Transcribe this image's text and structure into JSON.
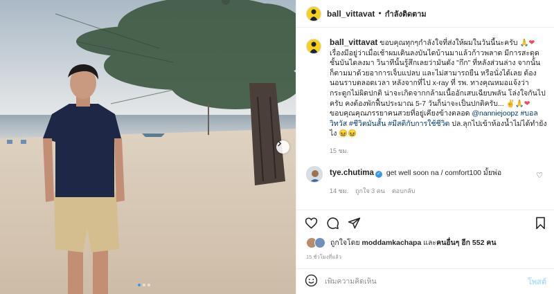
{
  "post": {
    "username": "ball_vittavat",
    "follow_state": "กำลังติดตาม",
    "separator": "•"
  },
  "caption": {
    "username": "ball_vittavat",
    "text_1": "ขอบคุณทุกๆกำลังใจที่ส่งให้ผมในวันนี้นะครับ",
    "emoji_1": "🙏",
    "heart_1": "❤",
    "text_2": " เรื่องมีอยู่ว่าเมื่อเช้าผมเดินลงบันไดบ้านมาแล้วก้าวพลาด มีการสะดุดชั้นบันไดลงมา วินาทีนั้นรู้สึกเลยว่ามันดัง \"กึก\" ที่หลังส่วนล่าง จากนั้นก็ตามมาด้วยอาการเจ็บแปลบ และไม่สามารถยืน หรือนั่งได้เลย ต้องนอนราบตลอดเวลา หลังจากที่ไป x-ray ที่ รพ. ทางคุณหมอแจ้งว่ากระดูกไม่ผิดปกติ น่าจะเกิดจากกล้ามเนื้ออักเสบเฉียบพลัน โล่งใจกันไปครับ คงต้องพักฟื้นประมาณ 5-7 วันก็น่าจะเป็นปกติครับ...",
    "emoji_2": "✌🙏",
    "heart_2": "❤",
    "text_3": " ขอบคุณคุณภรรยาคนสวยที่อยู่เคียงข้างตลอด ",
    "mention": "@nanniejoopz",
    "hashtag_1": "#บอลวิทวัส",
    "hashtag_2": "#ชีวิตมันสั้น",
    "hashtag_3": "#มีสติกับการใช้ชีวิต",
    "text_4": " ปล.ลุกไปเข้าห้องน้ำไม่ได้ทำยังไง",
    "emoji_3": "😖😖",
    "time": "15 ชม."
  },
  "comment": {
    "username": "tye.chutima",
    "verified_mark": "✓",
    "text": "get well soon na / comfort100 มั้ยพ่อ",
    "time": "14 ชม.",
    "likes": "ถูกใจ 3 คน",
    "reply_label": "ตอบกลับ",
    "heart_icon": "♡"
  },
  "likes": {
    "prefix": "ถูกใจโดย",
    "user": "moddamkachapa",
    "middle": "และ",
    "others": "คนอื่นๆ อีก 552 คน"
  },
  "post_date": "15 ชั่วโมงที่แล้ว",
  "add_comment": {
    "placeholder": "เพิ่มความคิดเห็น",
    "post_label": "โพสต์"
  },
  "icons": {
    "like": "heart-outline-icon",
    "comment": "comment-icon",
    "share": "paper-plane-icon",
    "save": "bookmark-icon",
    "emoji": "smiley-icon",
    "next": "chevron-right-icon"
  },
  "carousel": {
    "count": 3,
    "active_index": 1
  },
  "colors": {
    "link": "#00376b",
    "accent": "#3897f0",
    "heart": "#ed4956",
    "muted": "#8e8e8e"
  }
}
